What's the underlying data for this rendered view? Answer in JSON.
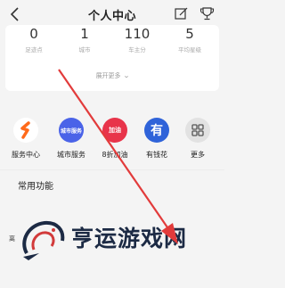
{
  "header": {
    "title": "个人中心",
    "back_icon": "chevron-left-icon",
    "edit_icon": "edit-icon",
    "trophy_icon": "trophy-icon"
  },
  "stats": [
    {
      "value": "0",
      "label": "足迹点"
    },
    {
      "value": "1",
      "label": "城市"
    },
    {
      "value": "110",
      "label": "车主分"
    },
    {
      "value": "5",
      "label": "平均星级"
    }
  ],
  "expand_more": "展开更多",
  "services": [
    {
      "label": "服务中心",
      "icon": "service-center-icon",
      "icon_text": "",
      "color": "#ff7a1a"
    },
    {
      "label": "城市服务",
      "icon": "city-service-icon",
      "icon_text": "城市服务",
      "color": "#4a63e8"
    },
    {
      "label": "8折加油",
      "icon": "fuel-discount-icon",
      "icon_text": "加油",
      "color": "#e8344a"
    },
    {
      "label": "有钱花",
      "icon": "youqianhua-icon",
      "icon_text": "有",
      "color": "#2f63d9"
    },
    {
      "label": "更多",
      "icon": "grid-more-icon",
      "icon_text": "",
      "color": "#e2e2e2"
    }
  ],
  "section": {
    "title": "常用功能"
  },
  "bottom_text": "离",
  "watermark": {
    "text": "亨运游戏网"
  },
  "colors": {
    "arrow": "#e23b3b",
    "background": "#f4f4f4",
    "card": "#ffffff"
  }
}
